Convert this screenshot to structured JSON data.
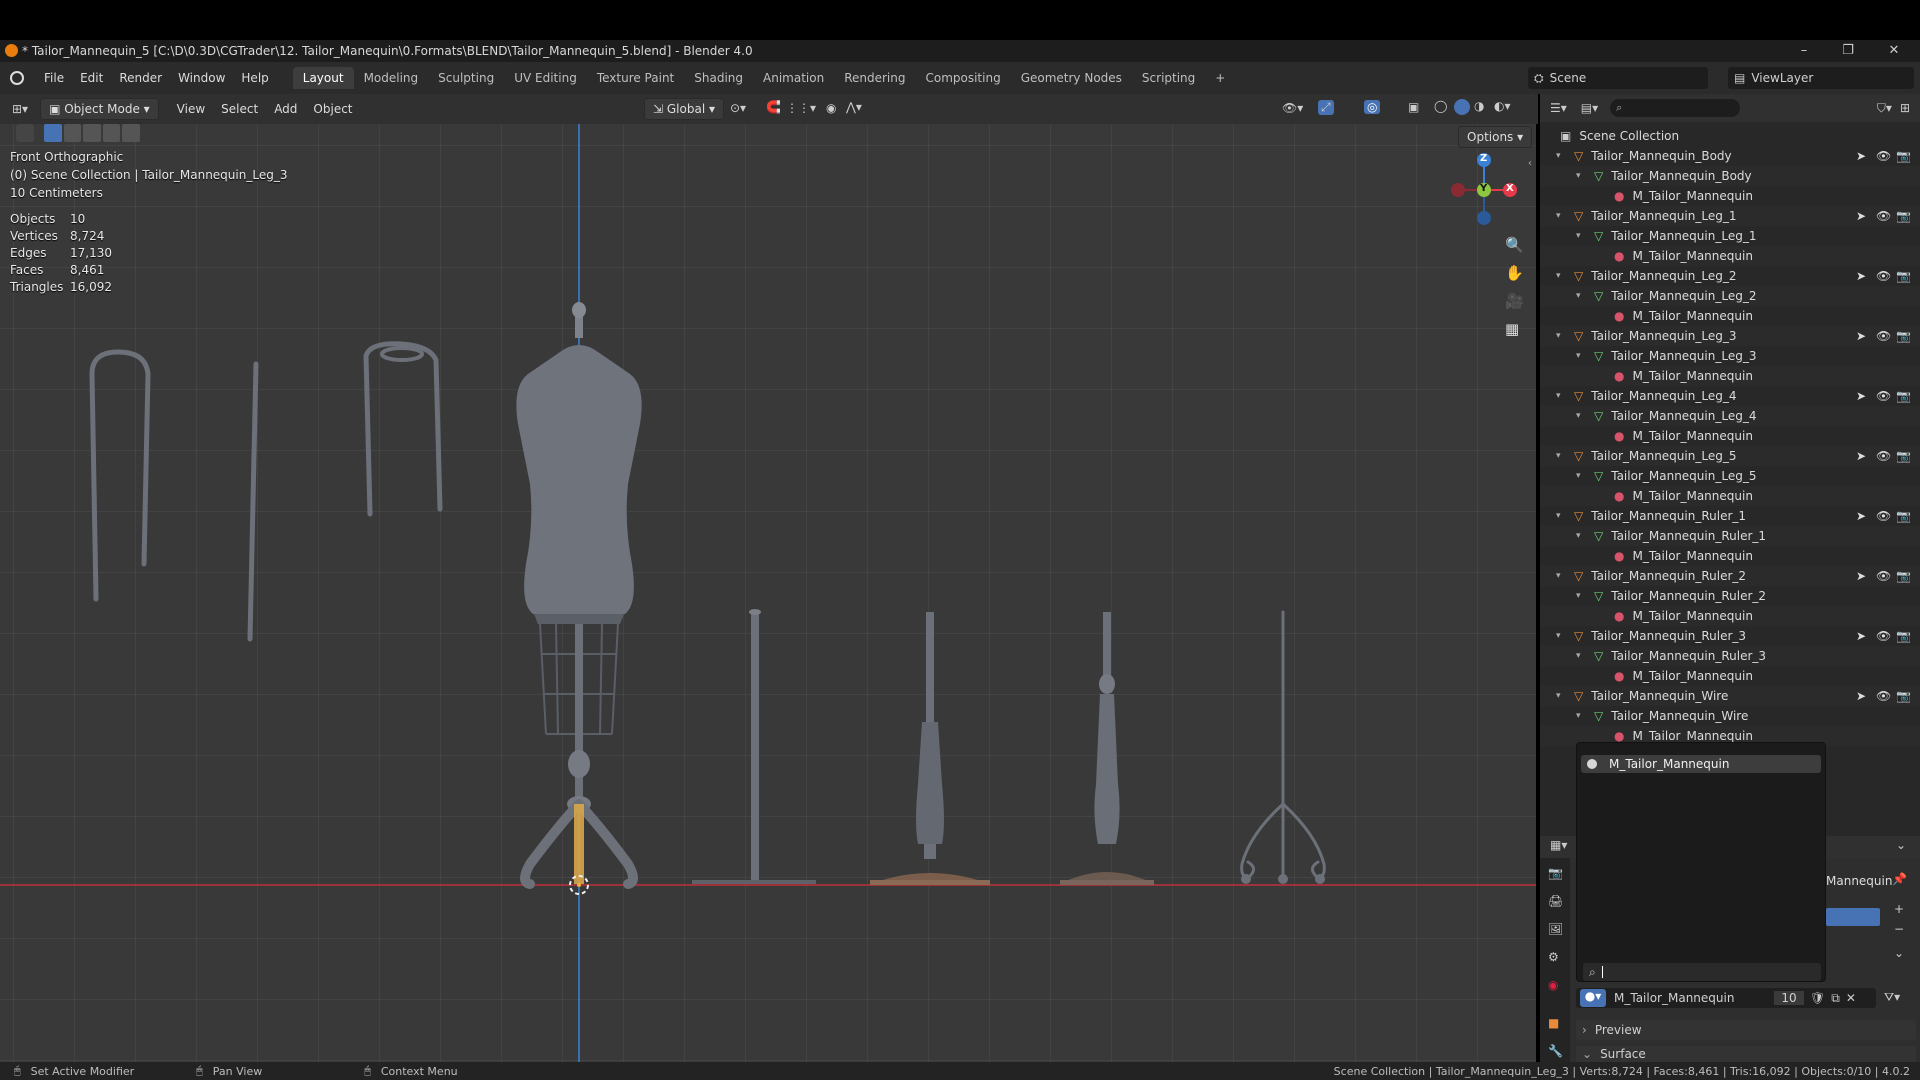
{
  "window": {
    "title": "* Tailor_Mannequin_5 [C:\\D\\0.3D\\CGTrader\\12. Tailor_Manequin\\0.Formats\\BLEND\\Tailor_Mannequin_5.blend] - Blender 4.0",
    "minimize": "–",
    "restore": "❐",
    "close": "✕"
  },
  "menus": [
    "File",
    "Edit",
    "Render",
    "Window",
    "Help"
  ],
  "workspace_tabs": [
    "Layout",
    "Modeling",
    "Sculpting",
    "UV Editing",
    "Texture Paint",
    "Shading",
    "Animation",
    "Rendering",
    "Compositing",
    "Geometry Nodes",
    "Scripting"
  ],
  "add_tab": "+",
  "scene": "Scene",
  "view_layer": "ViewLayer",
  "viewport_header": {
    "mode": "Object Mode",
    "menus": [
      "View",
      "Select",
      "Add",
      "Object"
    ],
    "transform_orientation": "Global",
    "options": "Options"
  },
  "overlay": {
    "view_name": "Front Orthographic",
    "collection_info": "(0) Scene Collection | Tailor_Mannequin_Leg_3",
    "scale": "10 Centimeters",
    "stats": [
      {
        "label": "Objects",
        "value": "10"
      },
      {
        "label": "Vertices",
        "value": "8,724"
      },
      {
        "label": "Edges",
        "value": "17,130"
      },
      {
        "label": "Faces",
        "value": "8,461"
      },
      {
        "label": "Triangles",
        "value": "16,092"
      }
    ]
  },
  "gizmo": {
    "z": "Z",
    "y": "Y",
    "x": "X"
  },
  "outliner": {
    "root": "Scene Collection",
    "objects": [
      {
        "name": "Tailor_Mannequin_Body",
        "mesh": "Tailor_Mannequin_Body",
        "material": "M_Tailor_Mannequin"
      },
      {
        "name": "Tailor_Mannequin_Leg_1",
        "mesh": "Tailor_Mannequin_Leg_1",
        "material": "M_Tailor_Mannequin"
      },
      {
        "name": "Tailor_Mannequin_Leg_2",
        "mesh": "Tailor_Mannequin_Leg_2",
        "material": "M_Tailor_Mannequin"
      },
      {
        "name": "Tailor_Mannequin_Leg_3",
        "mesh": "Tailor_Mannequin_Leg_3",
        "material": "M_Tailor_Mannequin"
      },
      {
        "name": "Tailor_Mannequin_Leg_4",
        "mesh": "Tailor_Mannequin_Leg_4",
        "material": "M_Tailor_Mannequin"
      },
      {
        "name": "Tailor_Mannequin_Leg_5",
        "mesh": "Tailor_Mannequin_Leg_5",
        "material": "M_Tailor_Mannequin"
      },
      {
        "name": "Tailor_Mannequin_Ruler_1",
        "mesh": "Tailor_Mannequin_Ruler_1",
        "material": "M_Tailor_Mannequin"
      },
      {
        "name": "Tailor_Mannequin_Ruler_2",
        "mesh": "Tailor_Mannequin_Ruler_2",
        "material": "M_Tailor_Mannequin"
      },
      {
        "name": "Tailor_Mannequin_Ruler_3",
        "mesh": "Tailor_Mannequin_Ruler_3",
        "material": "M_Tailor_Mannequin"
      },
      {
        "name": "Tailor_Mannequin_Wire",
        "mesh": "Tailor_Mannequin_Wire",
        "material": "M_Tailor_Mannequin"
      }
    ]
  },
  "material_dropdown": {
    "item": "M_Tailor_Mannequin",
    "search_value": ""
  },
  "properties": {
    "slot_label_partial": "Mannequin",
    "material_name": "M_Tailor_Mannequin",
    "users": "10",
    "preview": "Preview",
    "surface": "Surface"
  },
  "status_bar": {
    "left_action": "Set Active Modifier",
    "middle_action": "Pan View",
    "right_action": "Context Menu",
    "stats": "Scene Collection | Tailor_Mannequin_Leg_3 | Verts:8,724 | Faces:8,461 | Tris:16,092 | Objects:0/10 | 4.0.2"
  },
  "colors": {
    "accent_blue": "#4772b3",
    "object_orange": "#e88b3a",
    "mesh_green": "#6dcf7a",
    "axis_x": "#e6394a",
    "axis_y": "#8cc63f",
    "axis_z": "#3b82d6"
  }
}
